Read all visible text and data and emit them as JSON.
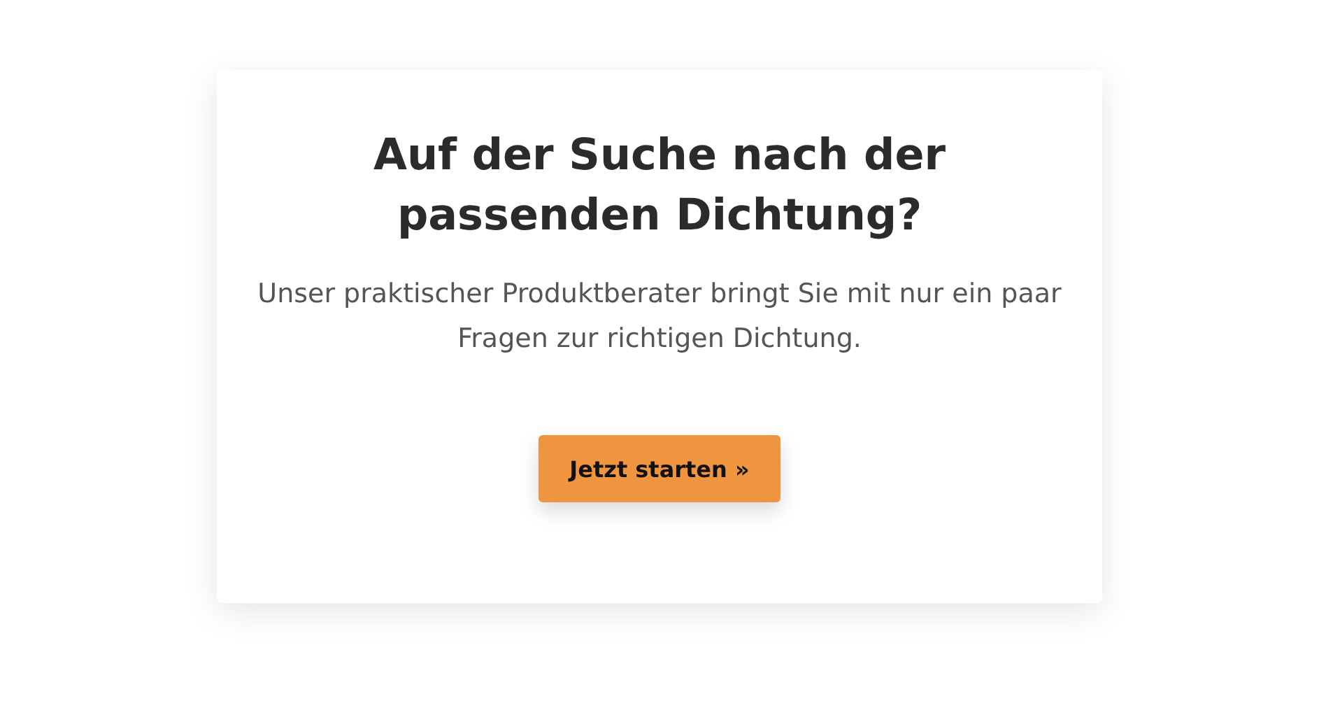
{
  "card": {
    "title": "Auf der Suche nach der passenden Dichtung?",
    "text": "Unser praktischer Produktberater bringt Sie mit nur ein paar Fragen zur richtigen Dichtung.",
    "button": "Jetzt starten »"
  }
}
